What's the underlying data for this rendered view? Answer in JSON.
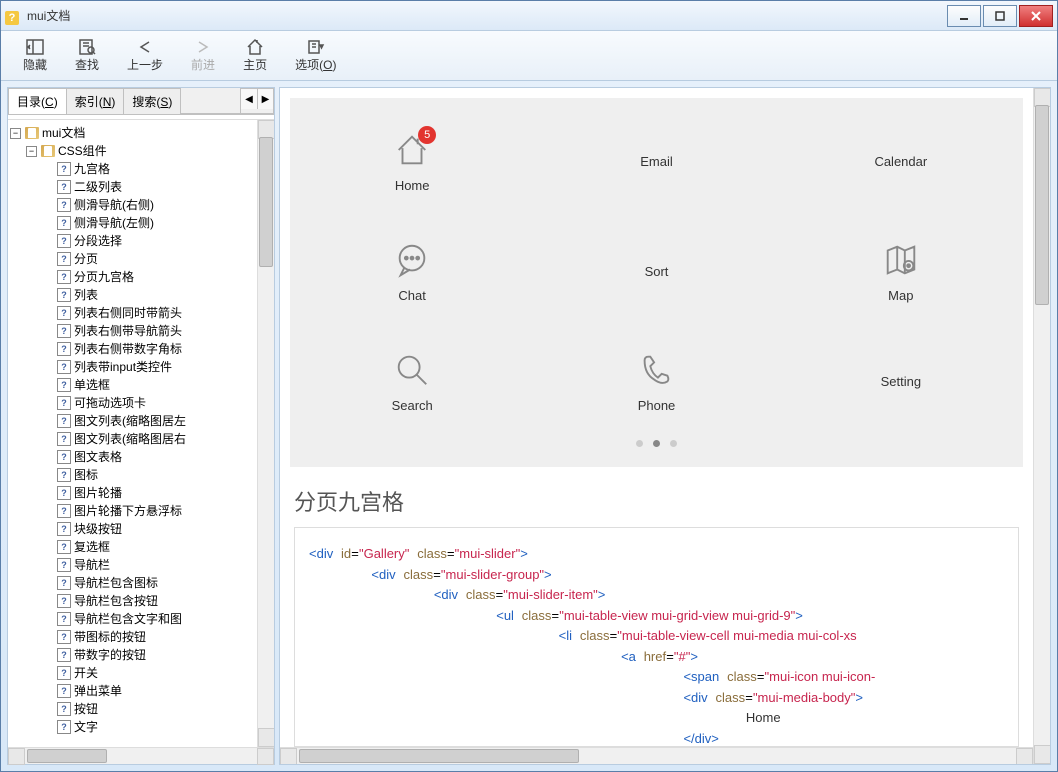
{
  "window": {
    "title": "mui文档"
  },
  "toolbar": {
    "hide": "隐藏",
    "find": "查找",
    "back": "上一步",
    "forward": "前进",
    "home": "主页",
    "options": "选项",
    "options_key": "O"
  },
  "tabs": {
    "contents": "目录",
    "contents_key": "C",
    "index": "索引",
    "index_key": "N",
    "search": "搜索",
    "search_key": "S"
  },
  "tree": {
    "root": "mui文档",
    "group": "CSS组件",
    "items": [
      "九宫格",
      "二级列表",
      "侧滑导航(右侧)",
      "侧滑导航(左侧)",
      "分段选择",
      "分页",
      "分页九宫格",
      "列表",
      "列表右侧同时带箭头",
      "列表右侧带导航箭头",
      "列表右侧带数字角标",
      "列表带input类控件",
      "单选框",
      "可拖动选项卡",
      "图文列表(缩略图居左",
      "图文列表(缩略图居右",
      "图文表格",
      "图标",
      "图片轮播",
      "图片轮播下方悬浮标",
      "块级按钮",
      "复选框",
      "导航栏",
      "导航栏包含图标",
      "导航栏包含按钮",
      "导航栏包含文字和图",
      "带图标的按钮",
      "带数字的按钮",
      "开关",
      "弹出菜单",
      "按钮",
      "文字"
    ]
  },
  "grid": {
    "badge": "5",
    "cells": [
      "Home",
      "Email",
      "Calendar",
      "Chat",
      "Sort",
      "Map",
      "Search",
      "Phone",
      "Setting"
    ]
  },
  "section_title": "分页九宫格",
  "code": {
    "home_text": "Home"
  }
}
